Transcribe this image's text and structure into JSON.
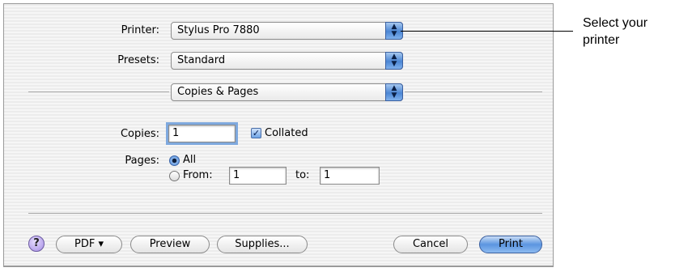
{
  "dialog": {
    "printer": {
      "label": "Printer:",
      "value": "Stylus Pro 7880"
    },
    "presets": {
      "label": "Presets:",
      "value": "Standard"
    },
    "panel": {
      "value": "Copies & Pages"
    },
    "copies": {
      "label": "Copies:",
      "value": "1",
      "collated_label": "Collated",
      "collated_checked": true
    },
    "pages": {
      "label": "Pages:",
      "all_label": "All",
      "from_label": "From:",
      "from_value": "1",
      "to_label": "to:",
      "to_value": "1",
      "selected": "All"
    },
    "buttons": {
      "help": "?",
      "pdf": "PDF ▾",
      "preview": "Preview",
      "supplies": "Supplies...",
      "cancel": "Cancel",
      "print": "Print"
    }
  },
  "callout": {
    "text": "Select your printer"
  },
  "colors": {
    "accent": "#4b86d4",
    "help": "#a58de3"
  }
}
